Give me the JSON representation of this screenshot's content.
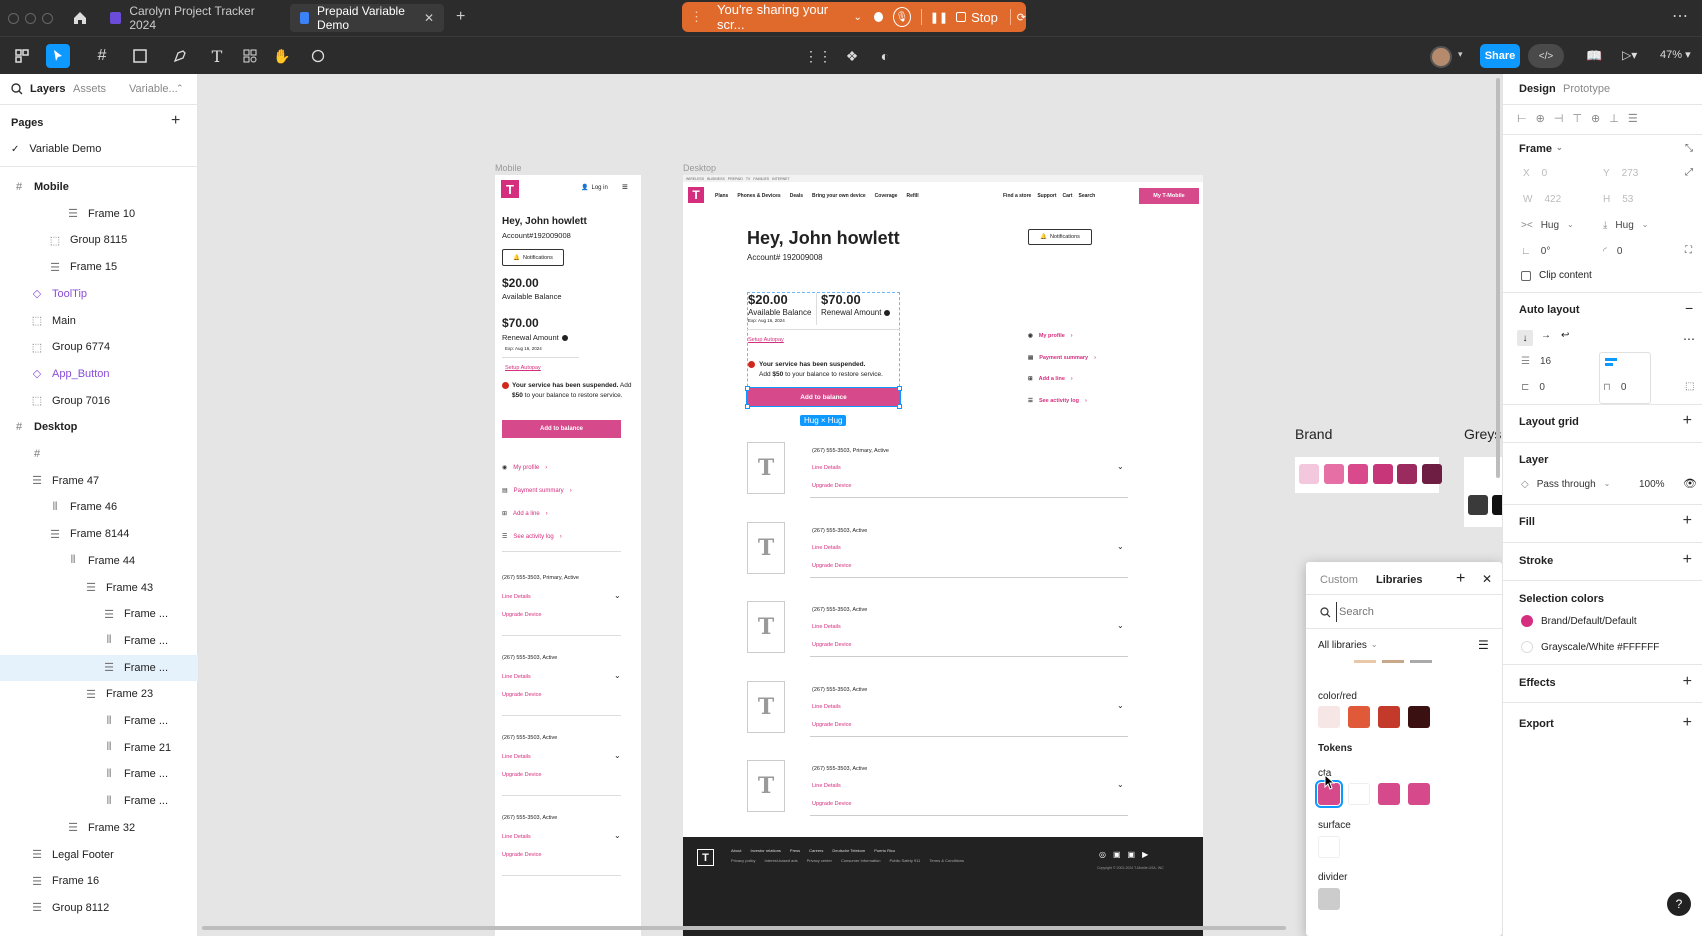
{
  "titlebar": {
    "tabs": [
      {
        "label": "Carolyn Project Tracker 2024"
      },
      {
        "label": "Prepaid Variable Demo"
      }
    ],
    "sharing_text": "You're sharing your scr...",
    "stop_label": "Stop"
  },
  "toolbar": {
    "share_label": "Share",
    "zoom": "47%"
  },
  "left_panel": {
    "tabs": [
      "Layers",
      "Assets",
      "Variable..."
    ],
    "pages_title": "Pages",
    "current_page": "Variable Demo",
    "layers": [
      {
        "label": "Mobile",
        "icon": "frame-icon",
        "indent": 0,
        "bold": true
      },
      {
        "label": "Frame 10",
        "icon": "autolayout-v-icon",
        "indent": 3
      },
      {
        "label": "Group 8115",
        "icon": "group-icon",
        "indent": 2
      },
      {
        "label": "Frame 15",
        "icon": "autolayout-v-icon",
        "indent": 2
      },
      {
        "label": "ToolTip",
        "icon": "component-icon",
        "indent": 1,
        "purple": true
      },
      {
        "label": "Main",
        "icon": "group-icon",
        "indent": 1
      },
      {
        "label": "Group 6774",
        "icon": "group-icon",
        "indent": 1
      },
      {
        "label": "App_Button",
        "icon": "component-icon",
        "indent": 1,
        "purple": true
      },
      {
        "label": "Group 7016",
        "icon": "group-icon",
        "indent": 1
      },
      {
        "label": "Desktop",
        "icon": "frame-icon",
        "indent": 0,
        "bold": true
      },
      {
        "label": "",
        "icon": "frame-icon",
        "indent": 1
      },
      {
        "label": "Frame 47",
        "icon": "autolayout-v-icon",
        "indent": 1
      },
      {
        "label": "Frame 46",
        "icon": "autolayout-h-icon",
        "indent": 2
      },
      {
        "label": "Frame 8144",
        "icon": "autolayout-v-icon",
        "indent": 2
      },
      {
        "label": "Frame 44",
        "icon": "autolayout-h-icon",
        "indent": 3
      },
      {
        "label": "Frame 43",
        "icon": "autolayout-v-icon",
        "indent": 4
      },
      {
        "label": "Frame ...",
        "icon": "autolayout-v-icon",
        "indent": 5
      },
      {
        "label": "Frame ...",
        "icon": "autolayout-h-icon",
        "indent": 5
      },
      {
        "label": "Frame ...",
        "icon": "autolayout-v-icon",
        "indent": 5,
        "selected": true
      },
      {
        "label": "Frame 23",
        "icon": "autolayout-v-icon",
        "indent": 4
      },
      {
        "label": "Frame ...",
        "icon": "autolayout-h-icon",
        "indent": 5
      },
      {
        "label": "Frame 21",
        "icon": "autolayout-h-icon",
        "indent": 5
      },
      {
        "label": "Frame ...",
        "icon": "autolayout-h-icon",
        "indent": 5
      },
      {
        "label": "Frame ...",
        "icon": "autolayout-h-icon",
        "indent": 5
      },
      {
        "label": "Frame 32",
        "icon": "autolayout-v-icon",
        "indent": 3
      },
      {
        "label": "Legal Footer",
        "icon": "autolayout-v-icon",
        "indent": 1
      },
      {
        "label": "Frame 16",
        "icon": "autolayout-v-icon",
        "indent": 1
      },
      {
        "label": "Group 8112",
        "icon": "autolayout-v-icon",
        "indent": 1
      }
    ]
  },
  "canvas": {
    "mobile_label": "Mobile",
    "desktop_label": "Desktop",
    "mobile": {
      "login": "Log in",
      "greeting": "Hey, John howlett",
      "account": "Account#192009008",
      "notifications": "Notifications",
      "balance": "$20.00",
      "balance_label": "Available Balance",
      "renewal": "$70.00",
      "renewal_label": "Renewal Amount",
      "exp": "Exp: Aug 16, 2024",
      "autopay": "Setup Autopay",
      "suspended": "Your service has been suspended.",
      "suspended_detail_a": "Add",
      "suspended_amount": "$50",
      "suspended_detail_b": "to your balance to restore service.",
      "add_balance": "Add to balance",
      "links": [
        "My profile",
        "Payment summary",
        "Add a line",
        "See activity log"
      ],
      "lines": [
        {
          "number": "(267) 555-3503, Primary, Active",
          "details": "Line Details",
          "upgrade": "Upgrade Device"
        },
        {
          "number": "(267) 555-3503, Active",
          "details": "Line Details",
          "upgrade": "Upgrade Device"
        },
        {
          "number": "(267) 555-3503, Active",
          "details": "Line Details",
          "upgrade": "Upgrade Device"
        },
        {
          "number": "(267) 555-3503, Active",
          "details": "Line Details",
          "upgrade": "Upgrade Device"
        }
      ]
    },
    "desktop": {
      "top_links": [
        "WIRELESS",
        "BUSINESS",
        "PREPAID",
        "TV",
        "FAMILIES",
        "INTERNET"
      ],
      "nav": [
        "Plans",
        "Phones & Devices",
        "Deals",
        "Bring your own device",
        "Coverage",
        "Refill"
      ],
      "nav_right": [
        "Find a store",
        "Support",
        "Cart",
        "Search"
      ],
      "my_tmobile": "My T-Mobile",
      "greeting": "Hey, John howlett",
      "account": "Account# 192009008",
      "notifications": "Notifications",
      "balance": "$20.00",
      "balance_label": "Available Balance",
      "exp": "Exp: Aug 16, 2024",
      "renewal": "$70.00",
      "renewal_label": "Renewal Amount",
      "autopay": "Setup Autopay",
      "suspended": "Your service has been suspended.",
      "suspended_detail_a": "Add",
      "suspended_amount": "$50",
      "suspended_detail_b": "to your balance to restore service.",
      "add_balance": "Add to balance",
      "hug_badge": "Hug × Hug",
      "links": [
        "My profile",
        "Payment summary",
        "Add a line",
        "See activity log"
      ],
      "lines": [
        {
          "number": "(267) 555-3503, Primary, Active",
          "details": "Line Details",
          "upgrade": "Upgrade Device"
        },
        {
          "number": "(267) 555-3503, Active",
          "details": "Line Details",
          "upgrade": "Upgrade Device"
        },
        {
          "number": "(267) 555-3503, Active",
          "details": "Line Details",
          "upgrade": "Upgrade Device"
        },
        {
          "number": "(267) 555-3503, Active",
          "details": "Line Details",
          "upgrade": "Upgrade Device"
        },
        {
          "number": "(267) 555-3503, Active",
          "details": "Line Details",
          "upgrade": "Upgrade Device"
        }
      ],
      "footer_links": [
        "About",
        "Investor relations",
        "Press",
        "Careers",
        "Deutsche Telekom",
        "Puerto Rico"
      ],
      "footer_links2": [
        "Privacy policy",
        "Interest-based ads",
        "Privacy center",
        "Consumer Information",
        "Public Safety 911",
        "Terms & Conditions"
      ],
      "copyright": "Copyright © 2002-2024 T-Mobile USA, INC"
    },
    "brand_title": "Brand",
    "greys_title": "Greys",
    "brand_colors": [
      "#f3c7dc",
      "#e66fa6",
      "#d94a8c",
      "#c8367a",
      "#9b2a5e",
      "#6e1d43"
    ],
    "grey_colors": [
      "#ffffff",
      "#3a3a3a",
      "#111111"
    ]
  },
  "library_popup": {
    "tabs": [
      "Custom",
      "Libraries"
    ],
    "search_placeholder": "Search",
    "filter": "All libraries",
    "groups": [
      {
        "name": "color/red",
        "colors": [
          "#f7e6e6",
          "#e05a3a",
          "#c43a2a",
          "#3a1010"
        ]
      },
      {
        "name": "Tokens",
        "heading": true,
        "colors": []
      },
      {
        "name": "cta",
        "colors": [
          "#d64a8b",
          "#ffffff",
          "#d64a8b",
          "#d64a8b"
        ]
      },
      {
        "name": "surface",
        "colors": [
          "#ffffff"
        ]
      },
      {
        "name": "divider",
        "colors": [
          "#cccccc"
        ]
      }
    ]
  },
  "right_panel": {
    "tabs": [
      "Design",
      "Prototype"
    ],
    "frame_label": "Frame",
    "x_label": "X",
    "x": "0",
    "y_label": "Y",
    "y": "273",
    "w_label": "W",
    "w": "422",
    "h_label": "H",
    "h": "53",
    "hug_w": "Hug",
    "hug_h": "Hug",
    "rotation": "0°",
    "radius": "0",
    "clip_content": "Clip content",
    "auto_layout": "Auto layout",
    "gap": "16",
    "pad_h": "0",
    "pad_v": "0",
    "layout_grid": "Layout grid",
    "layer": "Layer",
    "blend": "Pass through",
    "opacity": "100%",
    "fill": "Fill",
    "stroke": "Stroke",
    "selection_colors": "Selection colors",
    "sel_colors": [
      {
        "name": "Brand/Default/Default",
        "color": "#d62e7e"
      },
      {
        "name": "Grayscale/White #FFFFFF",
        "color": "#ffffff"
      }
    ],
    "effects": "Effects",
    "export": "Export",
    "help": "?"
  }
}
